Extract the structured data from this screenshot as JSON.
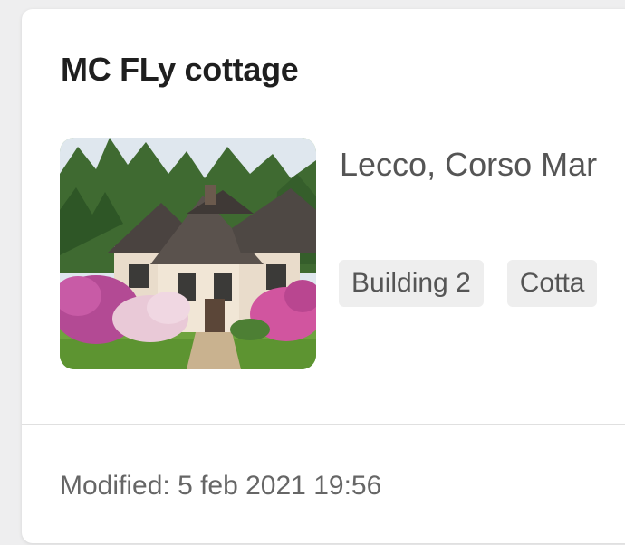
{
  "card": {
    "title": "MC FLy cottage",
    "address": "Lecco, Corso Mar",
    "image": "cottage-photo",
    "tags": [
      "Building 2",
      "Cotta"
    ],
    "modified": "Modified: 5 feb 2021 19:56"
  }
}
